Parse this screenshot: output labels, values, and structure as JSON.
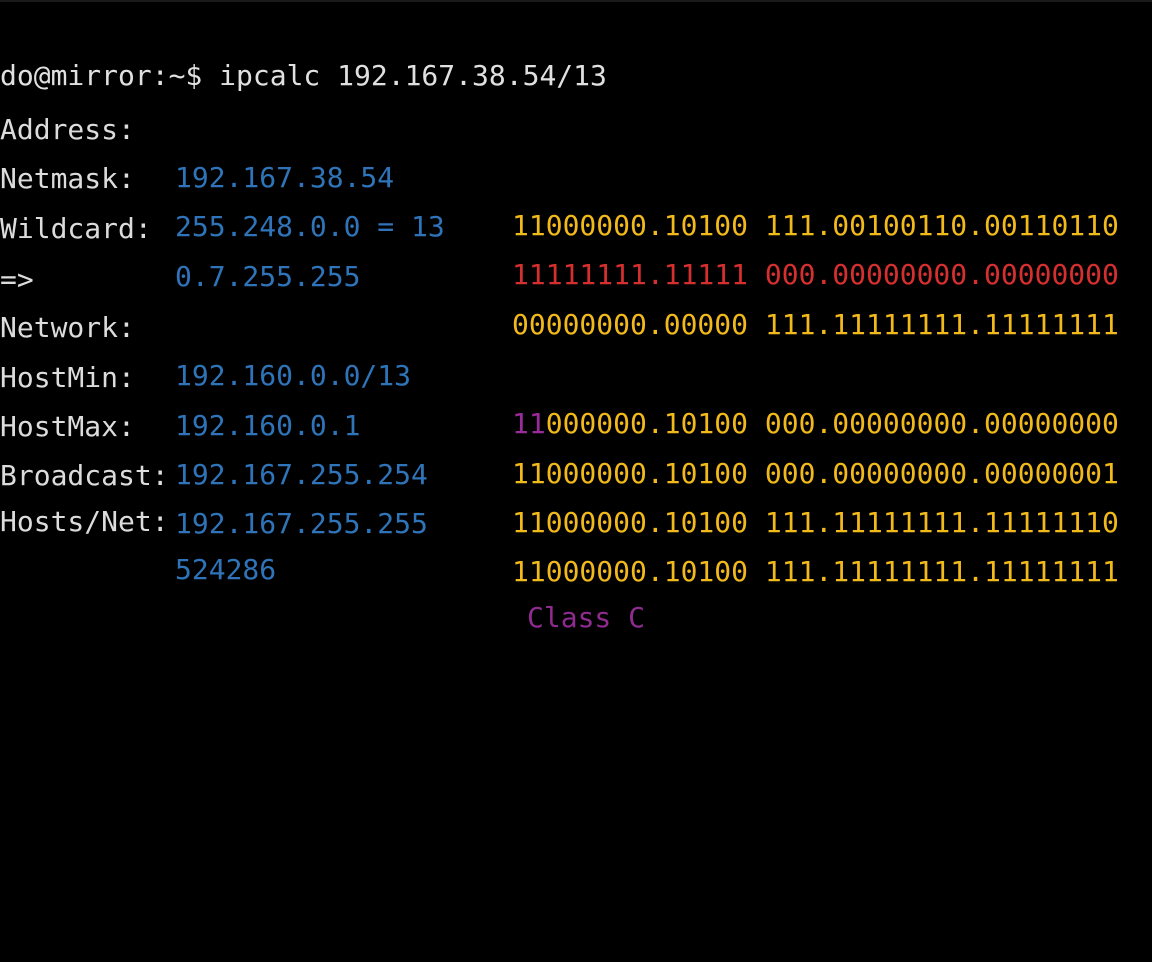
{
  "terminal": {
    "prompt": "do@mirror:~$ ipcalc 192.167.38.54/13",
    "rows": [
      {
        "label": "Address:",
        "value": "192.167.38.54",
        "bin": "11000000.10100 111.00100110.00110110"
      },
      {
        "label": "Netmask:",
        "value": "255.248.0.0 = 13",
        "bin": "11111111.11111 000.00000000.00000000"
      },
      {
        "label": "Wildcard:",
        "value": "0.7.255.255",
        "bin": "00000000.00000 111.11111111.11111111"
      },
      {
        "arrow": "=>"
      },
      {
        "label": "Network:",
        "value": "192.160.0.0/13",
        "bin_prefix": "11",
        "bin_rest": "000000.10100 000.00000000.00000000"
      },
      {
        "label": "HostMin:",
        "value": "192.160.0.1",
        "bin": "11000000.10100 000.00000000.00000001"
      },
      {
        "label": "HostMax:",
        "value": "192.167.255.254",
        "bin": "11000000.10100 111.11111111.11111110"
      },
      {
        "label": "Broadcast:",
        "value": "192.167.255.255",
        "bin": "11000000.10100 111.11111111.11111111"
      },
      {
        "label": "Hosts/Net:",
        "value": "524286",
        "class": "Class C"
      }
    ]
  },
  "colors": {
    "background": "#000000",
    "label": "#dcdcdc",
    "value": "#2f74b8",
    "binary": "#f2b91b",
    "netmask_binary": "#d62f2f",
    "class_bits": "#9b2b9b"
  }
}
